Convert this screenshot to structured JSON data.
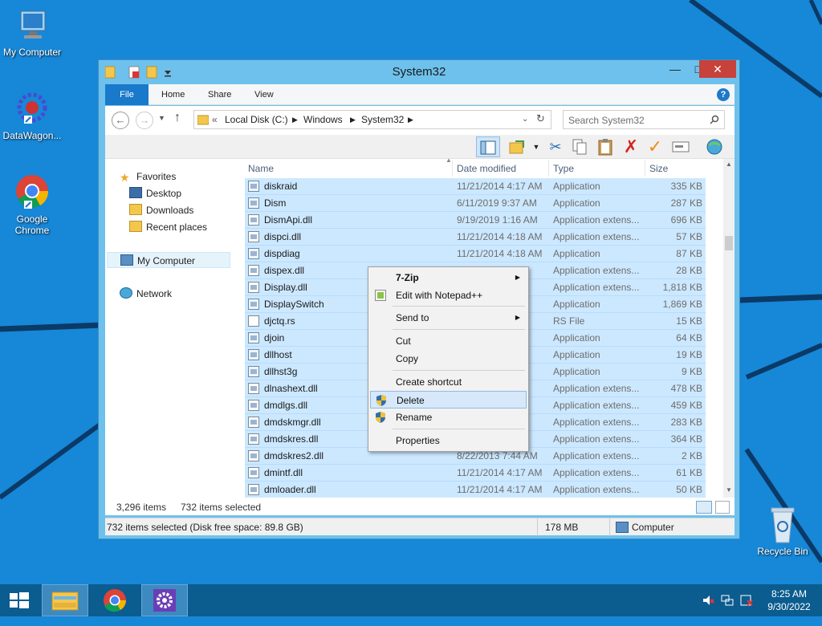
{
  "desktop": {
    "icons": [
      {
        "label": "My Computer"
      },
      {
        "label": "DataWagon..."
      },
      {
        "label": "Google Chrome"
      },
      {
        "label": "Recycle Bin"
      }
    ]
  },
  "window": {
    "title": "System32",
    "ribbon_tabs": [
      "File",
      "Home",
      "Share",
      "View"
    ],
    "help_label": "?",
    "address": {
      "prefix": "«",
      "crumbs": [
        "Local Disk (C:)",
        "Windows",
        "System32"
      ]
    },
    "search_placeholder": "Search System32",
    "nav": {
      "favorites": "Favorites",
      "desktop": "Desktop",
      "downloads": "Downloads",
      "recent": "Recent places",
      "computer": "My Computer",
      "network": "Network"
    },
    "columns": [
      "Name",
      "Date modified",
      "Type",
      "Size"
    ],
    "rows": [
      {
        "name": "diskraid",
        "date": "11/21/2014 4:17 AM",
        "type": "Application",
        "size": "335 KB"
      },
      {
        "name": "Dism",
        "date": "6/11/2019 9:37 AM",
        "type": "Application",
        "size": "287 KB"
      },
      {
        "name": "DismApi.dll",
        "date": "9/19/2019 1:16 AM",
        "type": "Application extens...",
        "size": "696 KB"
      },
      {
        "name": "dispci.dll",
        "date": "11/21/2014 4:18 AM",
        "type": "Application extens...",
        "size": "57 KB"
      },
      {
        "name": "dispdiag",
        "date": "11/21/2014 4:18 AM",
        "type": "Application",
        "size": "87 KB"
      },
      {
        "name": "dispex.dll",
        "date": "",
        "type": "Application extens...",
        "size": "28 KB"
      },
      {
        "name": "Display.dll",
        "date": "",
        "type": "Application extens...",
        "size": "1,818 KB"
      },
      {
        "name": "DisplaySwitch",
        "date": "",
        "type": "Application",
        "size": "1,869 KB"
      },
      {
        "name": "djctq.rs",
        "date": "",
        "type": "RS File",
        "size": "15 KB"
      },
      {
        "name": "djoin",
        "date": "",
        "type": "Application",
        "size": "64 KB"
      },
      {
        "name": "dllhost",
        "date": "",
        "type": "Application",
        "size": "19 KB"
      },
      {
        "name": "dllhst3g",
        "date": "",
        "type": "Application",
        "size": "9 KB"
      },
      {
        "name": "dlnashext.dll",
        "date": "",
        "type": "Application extens...",
        "size": "478 KB"
      },
      {
        "name": "dmdlgs.dll",
        "date": "",
        "type": "Application extens...",
        "size": "459 KB"
      },
      {
        "name": "dmdskmgr.dll",
        "date": "",
        "type": "Application extens...",
        "size": "283 KB"
      },
      {
        "name": "dmdskres.dll",
        "date": "",
        "type": "Application extens...",
        "size": "364 KB"
      },
      {
        "name": "dmdskres2.dll",
        "date": "8/22/2013 7:44 AM",
        "type": "Application extens...",
        "size": "2 KB"
      },
      {
        "name": "dmintf.dll",
        "date": "11/21/2014 4:17 AM",
        "type": "Application extens...",
        "size": "61 KB"
      },
      {
        "name": "dmloader.dll",
        "date": "11/21/2014 4:17 AM",
        "type": "Application extens...",
        "size": "50 KB"
      }
    ],
    "status": {
      "item_count": "3,296 items",
      "selected": "732 items selected",
      "bottom_left": "732 items selected (Disk free space: 89.8 GB)",
      "bottom_size": "178 MB",
      "bottom_location": "Computer"
    }
  },
  "context_menu": {
    "items": [
      {
        "label": "7-Zip",
        "submenu": "▶"
      },
      {
        "label": "Edit with Notepad++"
      },
      {
        "label": "Send to",
        "submenu": "▶"
      },
      {
        "label": "Cut"
      },
      {
        "label": "Copy"
      },
      {
        "label": "Create shortcut"
      },
      {
        "label": "Delete"
      },
      {
        "label": "Rename"
      },
      {
        "label": "Properties"
      }
    ]
  },
  "taskbar": {
    "time": "8:25 AM",
    "date": "9/30/2022"
  },
  "colors": {
    "desktop": "#1787d8",
    "selection": "#cce8ff",
    "title": "#6ec1ec",
    "file_tab": "#1979ca",
    "taskbar": "#0b5c8f"
  }
}
